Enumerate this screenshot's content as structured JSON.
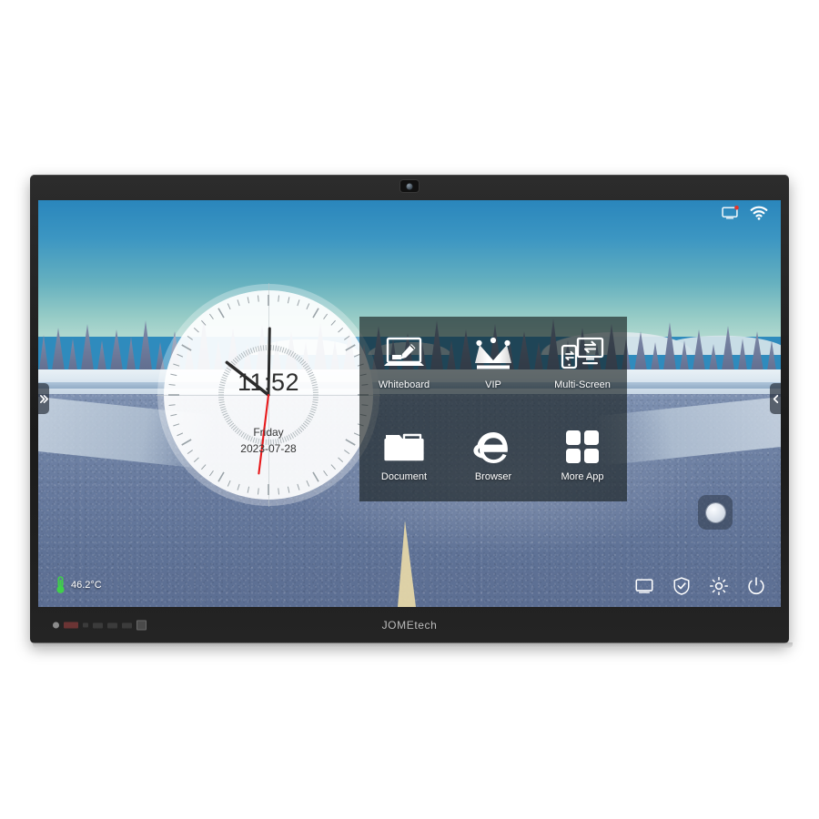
{
  "device": {
    "brand": "JOMEtech",
    "camera_icon": "camera-icon"
  },
  "status_bar": {
    "icons": [
      {
        "name": "screen-cast-icon",
        "badge": true,
        "badge_color": "#e0352b"
      },
      {
        "name": "wifi-icon",
        "badge": false
      }
    ]
  },
  "handles": {
    "left": {
      "name": "expand-right-handle",
      "glyph": "»"
    },
    "right": {
      "name": "collapse-left-handle",
      "glyph": "«"
    }
  },
  "clock": {
    "time": "11:52",
    "day": "Friday",
    "date": "2023-07-28",
    "hour_angle": -52,
    "minute_angle": 1,
    "second_angle": 187,
    "hand_color": "#2b2b2b",
    "second_hand_color": "#e8191b"
  },
  "app_panel": {
    "apps": [
      {
        "label": "Whiteboard",
        "icon": "whiteboard-icon"
      },
      {
        "label": "VIP",
        "icon": "crown-icon"
      },
      {
        "label": "Multi-Screen",
        "icon": "multi-screen-icon"
      },
      {
        "label": "Document",
        "icon": "folder-icon"
      },
      {
        "label": "Browser",
        "icon": "internet-explorer-icon"
      },
      {
        "label": "More App",
        "icon": "grid-apps-icon"
      }
    ]
  },
  "float_button": {
    "name": "floating-assistant-button"
  },
  "temperature": {
    "value": "46.2°C",
    "icon": "thermometer-icon",
    "color": "#3fd04a"
  },
  "system_tray": {
    "icons": [
      {
        "name": "screen-share-icon"
      },
      {
        "name": "shield-check-icon"
      },
      {
        "name": "settings-gear-icon"
      },
      {
        "name": "power-icon"
      }
    ]
  },
  "colors": {
    "sky_top": "#2a86bc",
    "sky_bottom": "#b0d8cf",
    "road": "#66799d",
    "panel_overlay": "rgba(22,30,30,.64)",
    "accent_red": "#e0352b",
    "temp_green": "#3fd04a"
  }
}
